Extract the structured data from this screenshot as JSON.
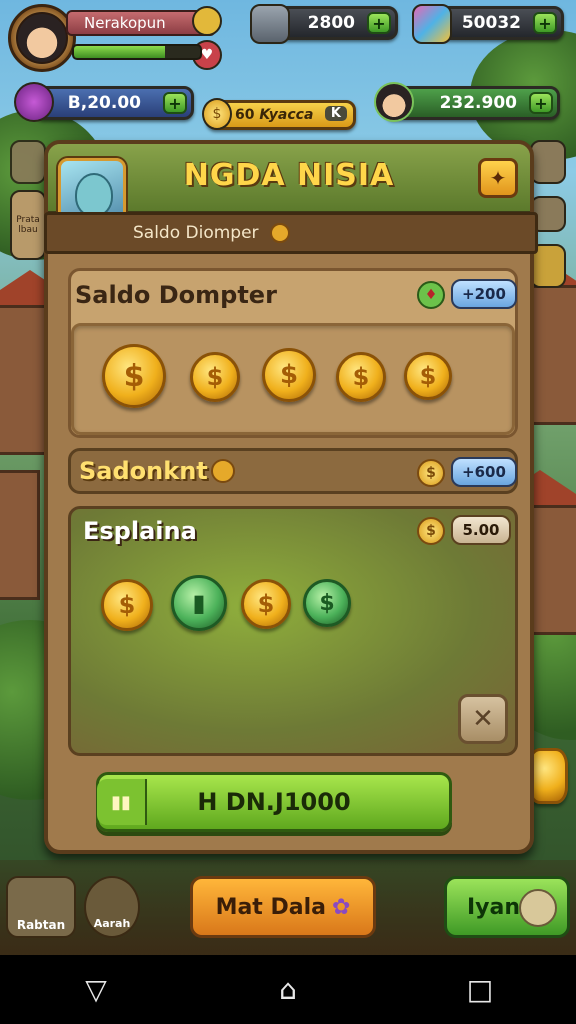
{
  "hud": {
    "player_name": "Nerakopun",
    "hp_fraction": 0.72,
    "currency_a": "2800",
    "currency_b": "50032",
    "gems": "B,20.00",
    "mid_value": "60",
    "mid_label": "Kyacca",
    "mid_suffix": "K",
    "coins": "232.900",
    "plus_label": "+"
  },
  "side": {
    "left_tab_label": "Prata lbau",
    "left_bottom_1": "Rabtan",
    "left_bottom_2": "Aarah"
  },
  "dialog": {
    "title": "NGDA NISIA",
    "subheader": "Saldo Diomper",
    "close_icon": "✦",
    "section1": {
      "label": "Saldo Dompter",
      "amount": "+200",
      "coin_symbol": "$"
    },
    "section2": {
      "label": "Sadonknt",
      "amount": "+600"
    },
    "section3": {
      "label": "Esplaina",
      "amount": "5.00"
    },
    "x_label": "✕",
    "buy_label": "H DN.J1000"
  },
  "bottom": {
    "main_button": "Mat Dala",
    "right_button": "Iyan"
  },
  "colors": {
    "accent_gold": "#ffd64a",
    "accent_green": "#5fa81e",
    "panel": "#c7a36f"
  },
  "nav": {
    "back_icon": "▽",
    "home_icon": "⌂",
    "recent_icon": "□"
  }
}
